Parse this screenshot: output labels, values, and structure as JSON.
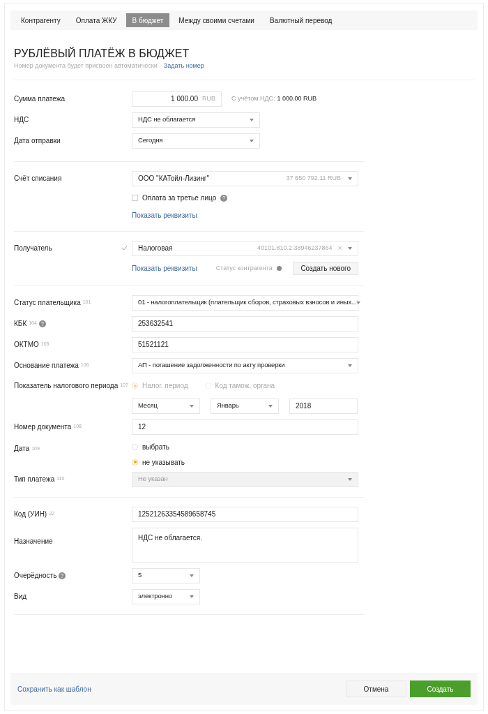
{
  "tabs": [
    {
      "label": "Контрагенту",
      "selected": false
    },
    {
      "label": "Оплата ЖКУ",
      "selected": false
    },
    {
      "label": "В бюджет",
      "selected": true
    },
    {
      "label": "Между своими счетами",
      "selected": false
    },
    {
      "label": "Валютный перевод",
      "selected": false
    }
  ],
  "title": "РУБЛЁВЫЙ ПЛАТЁЖ В БЮДЖЕТ",
  "subtitle": "Номер документа будет присвоен автоматически",
  "subtitle_link": "Задать номер",
  "sections": [
    {
      "rows": [
        {
          "kind": "amount",
          "label": "Сумма платежа",
          "value": "1 000.00",
          "currency": "RUB",
          "note_label": "С учётом НДС:",
          "note_value": "1 000.00 RUB"
        },
        {
          "kind": "medium_select",
          "label": "НДС",
          "value": "НДС не облагается"
        },
        {
          "kind": "medium_select",
          "label": "Дата отправки",
          "value": "Сегодня"
        }
      ]
    },
    {
      "rows": [
        {
          "kind": "account",
          "label": "Счёт списания",
          "value": "ООО \"КАТойл-Лизинг\"",
          "balance": "37 650 792.11 RUB"
        },
        {
          "kind": "checkbox",
          "label": "Оплата за третье лицо",
          "checked": false,
          "help": true
        },
        {
          "kind": "link",
          "text": "Показать реквизиты"
        }
      ]
    },
    {
      "rows": [
        {
          "kind": "recipient",
          "label": "Получатель",
          "valid": true,
          "value": "Налоговая",
          "account": "40101.810.2.38946237864",
          "clear": "×"
        },
        {
          "kind": "recipient_actions",
          "link": "Показать реквизиты",
          "status": "Статус контрагента",
          "button": "Создать нового"
        }
      ]
    },
    {
      "rows": [
        {
          "kind": "select",
          "label": "Статус плательщика",
          "code": "101",
          "value": "01 - налогоплательщик (плательщик сборов, страховых взносов и иных..."
        },
        {
          "kind": "input",
          "label": "КБК",
          "code": "104",
          "help": true,
          "value": "253632541"
        },
        {
          "kind": "input",
          "label": "ОКТМО",
          "code": "105",
          "value": "51521121"
        },
        {
          "kind": "select",
          "label": "Основание платежа",
          "code": "106",
          "value": "АП - погашение задолженности по акту проверки"
        },
        {
          "kind": "radio_inline",
          "label": "Показатель налогового периода",
          "code": "107",
          "options": [
            {
              "label": "Налог. период",
              "selected": true,
              "disabled": true
            },
            {
              "label": "Код тамож. органа",
              "selected": false,
              "disabled": true
            }
          ]
        },
        {
          "kind": "period",
          "selects": [
            "Месяц",
            "Январь"
          ],
          "year": "2018"
        },
        {
          "kind": "input",
          "label": "Номер документа",
          "code": "108",
          "value": "12"
        },
        {
          "kind": "radio_stack",
          "label": "Дата",
          "code": "109",
          "options": [
            {
              "label": "выбрать",
              "selected": false,
              "disabled": false
            },
            {
              "label": "не указывать",
              "selected": true,
              "disabled": false
            }
          ]
        },
        {
          "kind": "select",
          "label": "Тип платежа",
          "code": "110",
          "value": "Не указан",
          "disabled": true
        }
      ]
    },
    {
      "rows": [
        {
          "kind": "input",
          "label": "Код (УИН)",
          "code": "22",
          "value": "12521263354589658745"
        },
        {
          "kind": "textarea",
          "label": "Назначение",
          "value": "НДС не облагается."
        },
        {
          "kind": "short_select",
          "label": "Очерёдность",
          "help": true,
          "value": "5"
        },
        {
          "kind": "short_select",
          "label": "Вид",
          "value": "электронно"
        }
      ]
    }
  ],
  "footer": {
    "link": "Сохранить как шаблон",
    "cancel": "Отмена",
    "submit": "Создать"
  }
}
